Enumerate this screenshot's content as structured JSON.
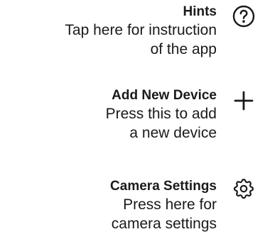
{
  "hints_overlay": {
    "items": [
      {
        "title": "Hints",
        "description_lines": [
          "Tap here for instruction",
          "of the app"
        ],
        "icon": "question-circle-icon"
      },
      {
        "title": "Add New Device",
        "description_lines": [
          "Press this to add",
          "a new device"
        ],
        "icon": "plus-icon"
      },
      {
        "title": "Camera Settings",
        "description_lines": [
          "Press here for",
          "camera settings"
        ],
        "icon": "gear-icon"
      }
    ]
  }
}
